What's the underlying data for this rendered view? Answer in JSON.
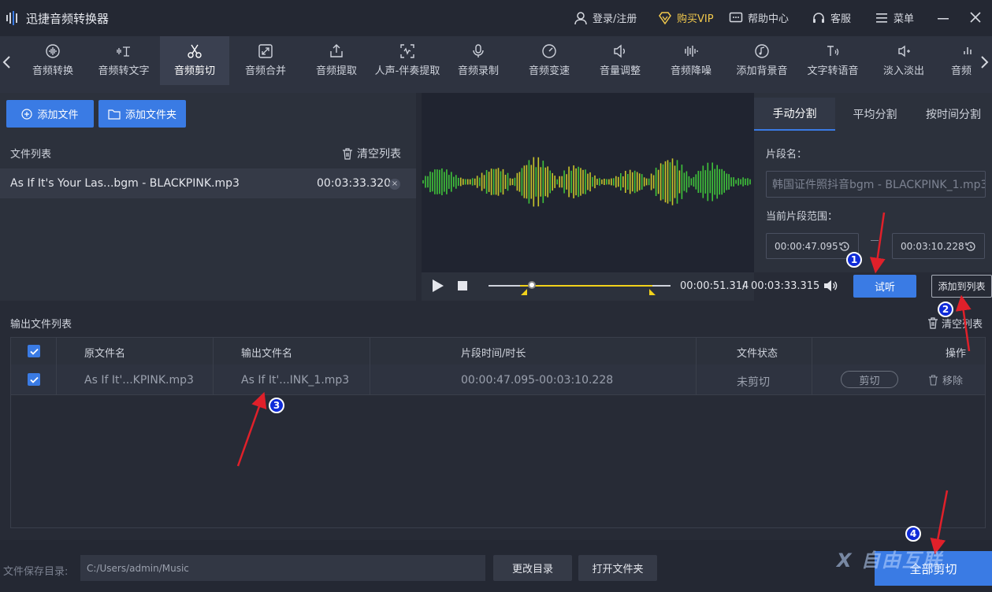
{
  "app": {
    "title": "迅捷音频转换器"
  },
  "topbar": {
    "login": "登录/注册",
    "buy_vip": "购买VIP",
    "help": "帮助中心",
    "service": "客服",
    "menu": "菜单"
  },
  "tools": [
    {
      "label": "音频转换",
      "icon": "audio-convert-icon"
    },
    {
      "label": "音频转文字",
      "icon": "audio-to-text-icon"
    },
    {
      "label": "音频剪切",
      "icon": "scissors-icon",
      "active": true
    },
    {
      "label": "音频合并",
      "icon": "merge-icon"
    },
    {
      "label": "音频提取",
      "icon": "extract-icon"
    },
    {
      "label": "人声-伴奏提取",
      "icon": "vocal-extract-icon"
    },
    {
      "label": "音频录制",
      "icon": "microphone-icon"
    },
    {
      "label": "音频变速",
      "icon": "speed-icon"
    },
    {
      "label": "音量调整",
      "icon": "volume-adjust-icon"
    },
    {
      "label": "音频降噪",
      "icon": "denoise-icon"
    },
    {
      "label": "添加背景音",
      "icon": "background-music-icon"
    },
    {
      "label": "文字转语音",
      "icon": "text-to-speech-icon"
    },
    {
      "label": "淡入淡出",
      "icon": "fade-icon"
    },
    {
      "label": "音频",
      "icon": "audio-more-icon"
    }
  ],
  "left_panel": {
    "add_file": "添加文件",
    "add_folder": "添加文件夹",
    "file_list_title": "文件列表",
    "clear_list": "清空列表",
    "file": {
      "name": "As If It's Your Las...bgm - BLACKPINK.mp3",
      "duration": "00:03:33.320"
    }
  },
  "player": {
    "current_time": "00:00:51.314",
    "separator": "/",
    "total_time": "00:03:33.315",
    "progress_fraction": 0.24
  },
  "split": {
    "tabs": [
      "手动分割",
      "平均分割",
      "按时间分割"
    ],
    "segment_name_label": "片段名：",
    "segment_name_placeholder": "韩国证件照抖音bgm - BLACKPINK_1.mp3",
    "range_label": "当前片段范围：",
    "start": "00:00:47.095",
    "end": "00:03:10.228",
    "preview": "试听",
    "add_to_list": "添加到列表"
  },
  "output": {
    "title": "输出文件列表",
    "clear_list": "清空列表",
    "columns": [
      "原文件名",
      "输出文件名",
      "片段时间/时长",
      "文件状态",
      "操作"
    ],
    "row": {
      "source": "As If It'...KPINK.mp3",
      "output": "As If It'...INK_1.mp3",
      "time": "00:00:47.095-00:03:10.228",
      "status": "未剪切",
      "cut": "剪切",
      "remove": "移除"
    }
  },
  "footer": {
    "save_dir_label": "文件保存目录:",
    "save_dir": "C:/Users/admin/Music",
    "change_dir": "更改目录",
    "open_folder": "打开文件夹",
    "cut_all": "全部剪切"
  },
  "annotations": {
    "badges": [
      "1",
      "2",
      "3",
      "4"
    ],
    "watermark": "自由互联"
  },
  "colors": {
    "accent": "#3a7be4",
    "wave_green": "#3fc43a",
    "wave_yellow": "#c9c52a",
    "marker": "#f2d21b",
    "arrow": "#e0202a"
  }
}
